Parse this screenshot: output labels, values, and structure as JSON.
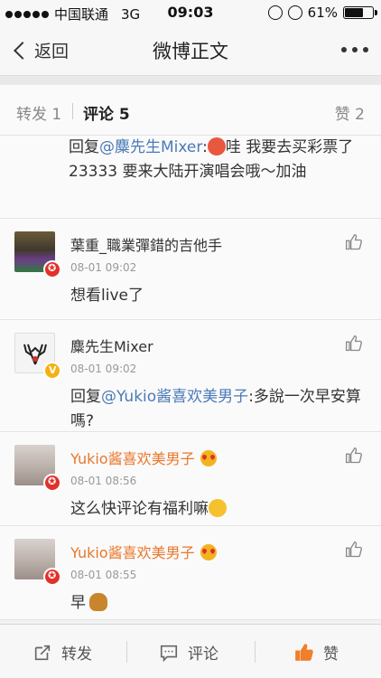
{
  "status_bar": {
    "carrier": "中国联通",
    "network": "3G",
    "time": "09:03",
    "battery": "61%",
    "battery_level": 0.61
  },
  "nav": {
    "back_label": "返回",
    "title": "微博正文"
  },
  "tabs": {
    "repost": "转发 1",
    "comment": "评论 5",
    "like": "赞 2"
  },
  "comments": [
    {
      "partial_reply_prefix": "回复",
      "partial_mention": "@麋先生Mixer",
      "partial_text": ":",
      "partial_text_2": "哇 我要去买彩票了 23333 要来大陆开演唱会哦～加油"
    },
    {
      "name": "葉重_職業彈錯的吉他手",
      "time": "08-01 09:02",
      "text": "想看live了"
    },
    {
      "name": "麋先生Mixer",
      "time": "08-01 09:02",
      "reply_prefix": "回复",
      "mention": "@Yukio酱喜欢美男子",
      "text": ":多說一次早安算嗎?"
    },
    {
      "name": "Yukio酱喜欢美男子",
      "time": "08-01 08:56",
      "text": "这么快评论有福利嘛"
    },
    {
      "name": "Yukio酱喜欢美男子",
      "time": "08-01 08:55",
      "text": "早"
    }
  ],
  "toolbar": {
    "repost": "转发",
    "comment": "评论",
    "like": "赞"
  },
  "colors": {
    "mention": "#4a7ab8",
    "orange_name": "#e8782d",
    "like_active": "#f07e2a"
  }
}
